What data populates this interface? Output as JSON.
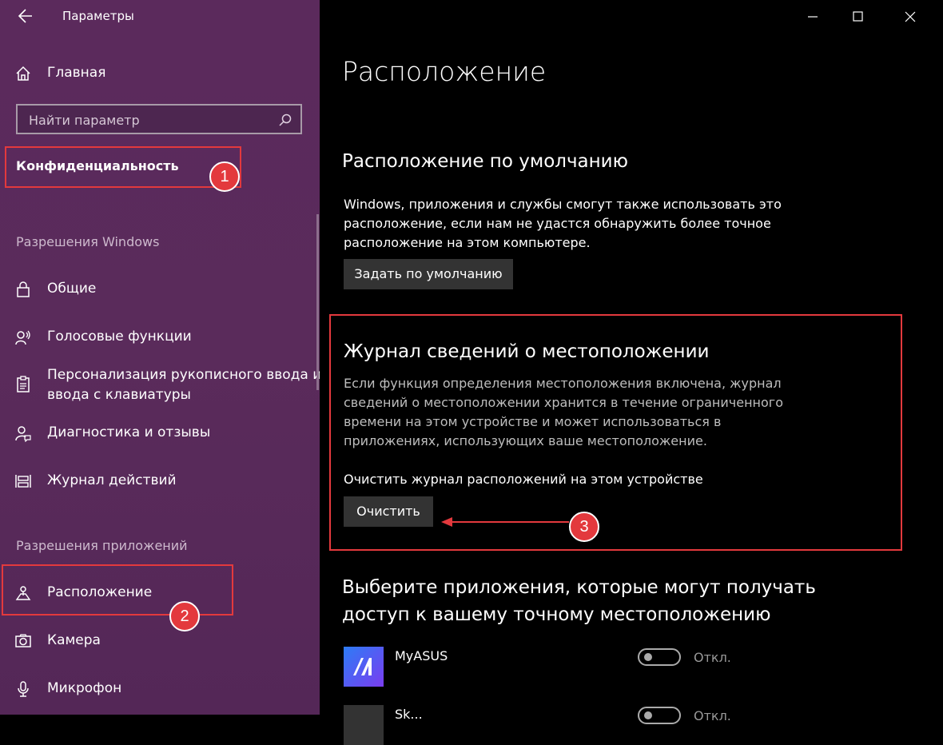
{
  "window": {
    "title": "Параметры"
  },
  "sidebar": {
    "home_label": "Главная",
    "search": {
      "placeholder": "Найти параметр"
    },
    "category": "Конфиденциальность",
    "sections": [
      {
        "header": "Разрешения Windows",
        "items": [
          {
            "label": "Общие",
            "icon": "lock-icon"
          },
          {
            "label": "Голосовые функции",
            "icon": "speech-icon"
          },
          {
            "label": "Персонализация рукописного ввода и",
            "label2": "ввода с клавиатуры",
            "icon": "clipboard-icon"
          },
          {
            "label": "Диагностика и отзывы",
            "icon": "feedback-icon"
          },
          {
            "label": "Журнал действий",
            "icon": "timeline-icon"
          }
        ]
      },
      {
        "header": "Разрешения приложений",
        "items": [
          {
            "label": "Расположение",
            "icon": "location-icon"
          },
          {
            "label": "Камера",
            "icon": "camera-icon"
          },
          {
            "label": "Микрофон",
            "icon": "microphone-icon"
          }
        ]
      }
    ]
  },
  "annotations": {
    "badge1": "1",
    "badge2": "2",
    "badge3": "3"
  },
  "main": {
    "page_title": "Расположение",
    "default_location": {
      "heading": "Расположение по умолчанию",
      "lines": [
        "Windows, приложения и службы смогут также использовать это",
        "расположение, если нам не удастся обнаружить более точное",
        "расположение на этом компьютере."
      ],
      "button": "Задать по умолчанию"
    },
    "history": {
      "heading": "Журнал сведений о местоположении",
      "lines": [
        "Если функция определения местоположения включена, журнал",
        "сведений о местоположении хранится в течение ограниченного",
        "времени на этом устройстве и может использоваться в",
        "приложениях, использующих ваше местоположение."
      ],
      "clear_label": "Очистить журнал расположений на этом устройстве",
      "button": "Очистить"
    },
    "apps": {
      "heading_line1": "Выберите приложения, которые могут получать",
      "heading_line2": "доступ к вашему точному местоположению",
      "list": [
        {
          "name": "MyASUS",
          "state": "Откл."
        },
        {
          "name": "Sk...",
          "state": "Откл."
        }
      ]
    }
  },
  "colors": {
    "sidebar_bg": "#5b2a5c",
    "accent_red": "#e3393d",
    "button_bg": "#333333"
  }
}
